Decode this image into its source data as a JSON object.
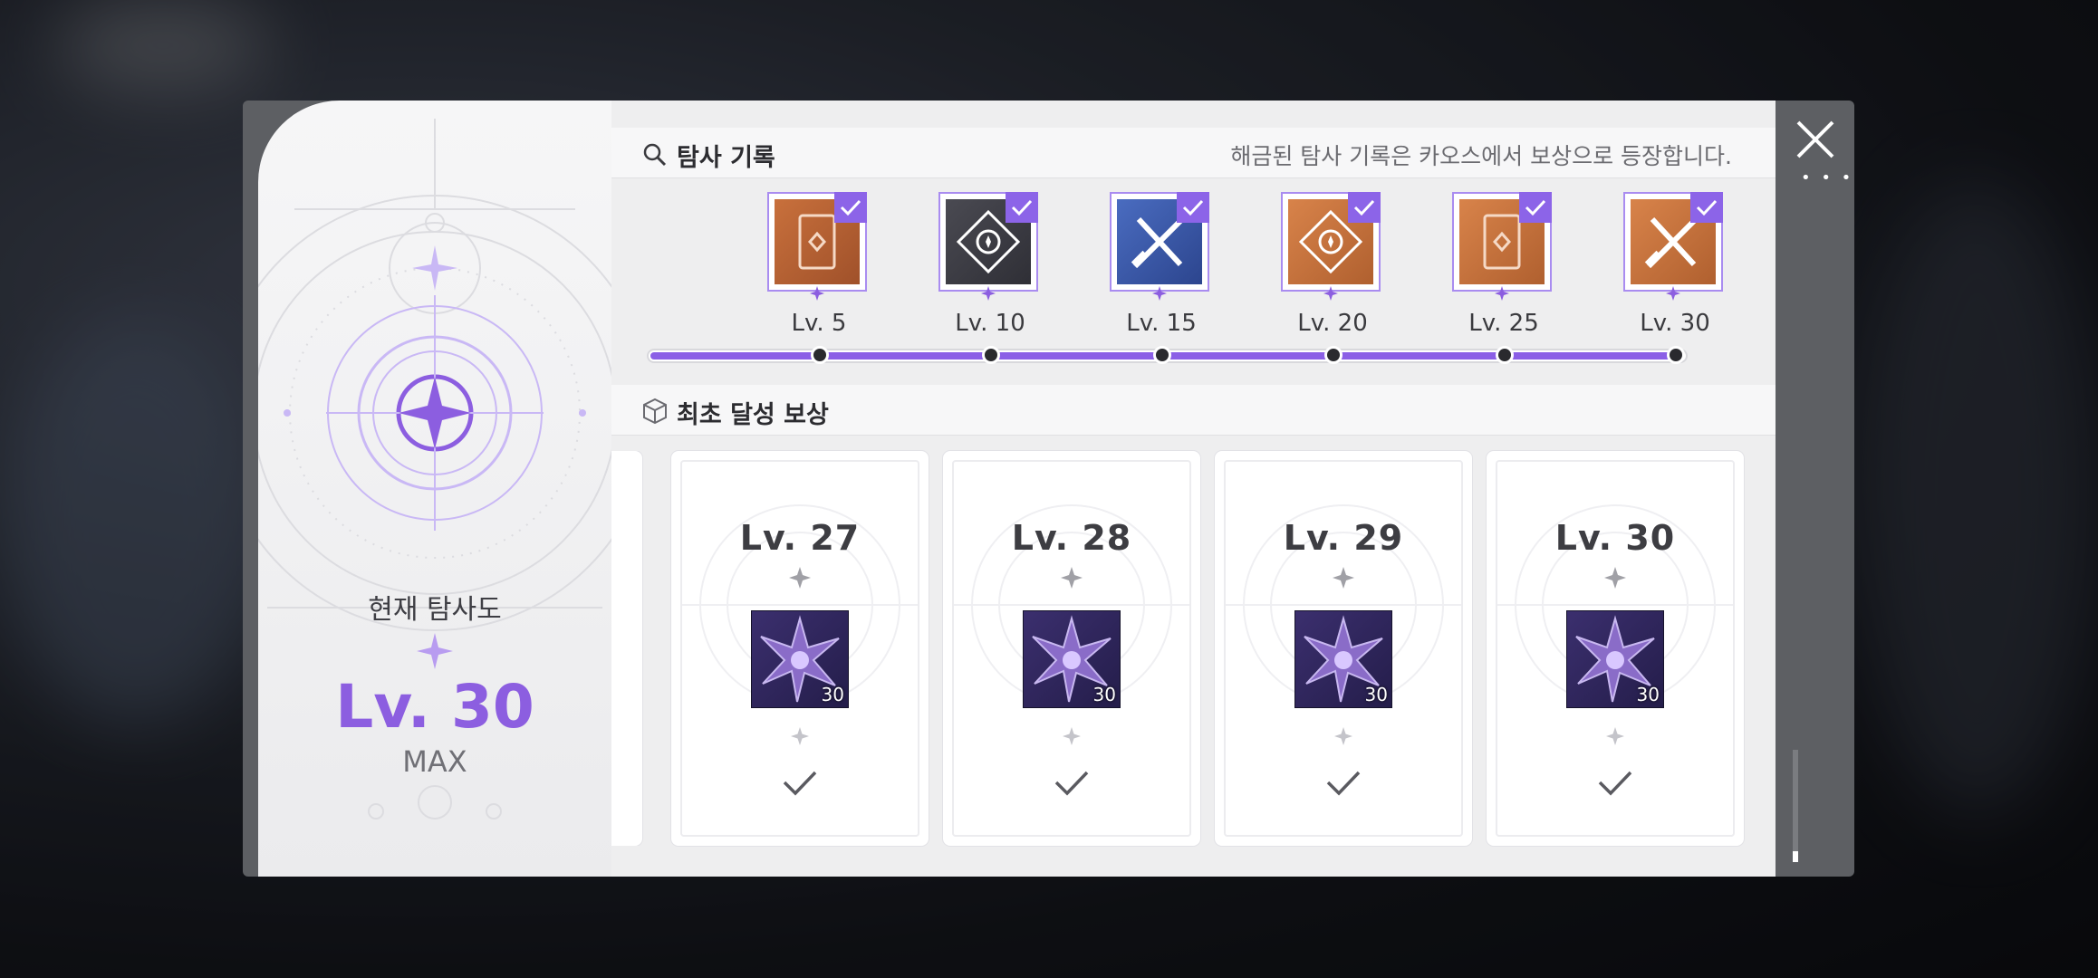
{
  "left": {
    "title": "현재 탐사도",
    "level": "Lv. 30",
    "max_label": "MAX",
    "accent_color": "#8c5ee0"
  },
  "records": {
    "title": "탐사 기록",
    "note": "해금된 탐사 기록은 카오스에서 보상으로 등장합니다.",
    "items": [
      {
        "label": "Lv. 5",
        "icon": "card-icon",
        "color": "orange"
      },
      {
        "label": "Lv. 10",
        "icon": "target-diamond-icon",
        "color": "dark"
      },
      {
        "label": "Lv. 15",
        "icon": "crossed-swords-icon",
        "color": "blue"
      },
      {
        "label": "Lv. 20",
        "icon": "target-diamond-icon",
        "color": "orange"
      },
      {
        "label": "Lv. 25",
        "icon": "card-icon",
        "color": "orange"
      },
      {
        "label": "Lv. 30",
        "icon": "crossed-swords-icon",
        "color": "orange"
      }
    ],
    "progress": 1.0
  },
  "rewards": {
    "title": "최초 달성 보상",
    "cards": [
      {
        "level": "Lv. 27",
        "count": "30",
        "claimed": true
      },
      {
        "level": "Lv. 28",
        "count": "30",
        "claimed": true
      },
      {
        "level": "Lv. 29",
        "count": "30",
        "claimed": true
      },
      {
        "level": "Lv. 30",
        "count": "30",
        "claimed": true
      }
    ]
  }
}
